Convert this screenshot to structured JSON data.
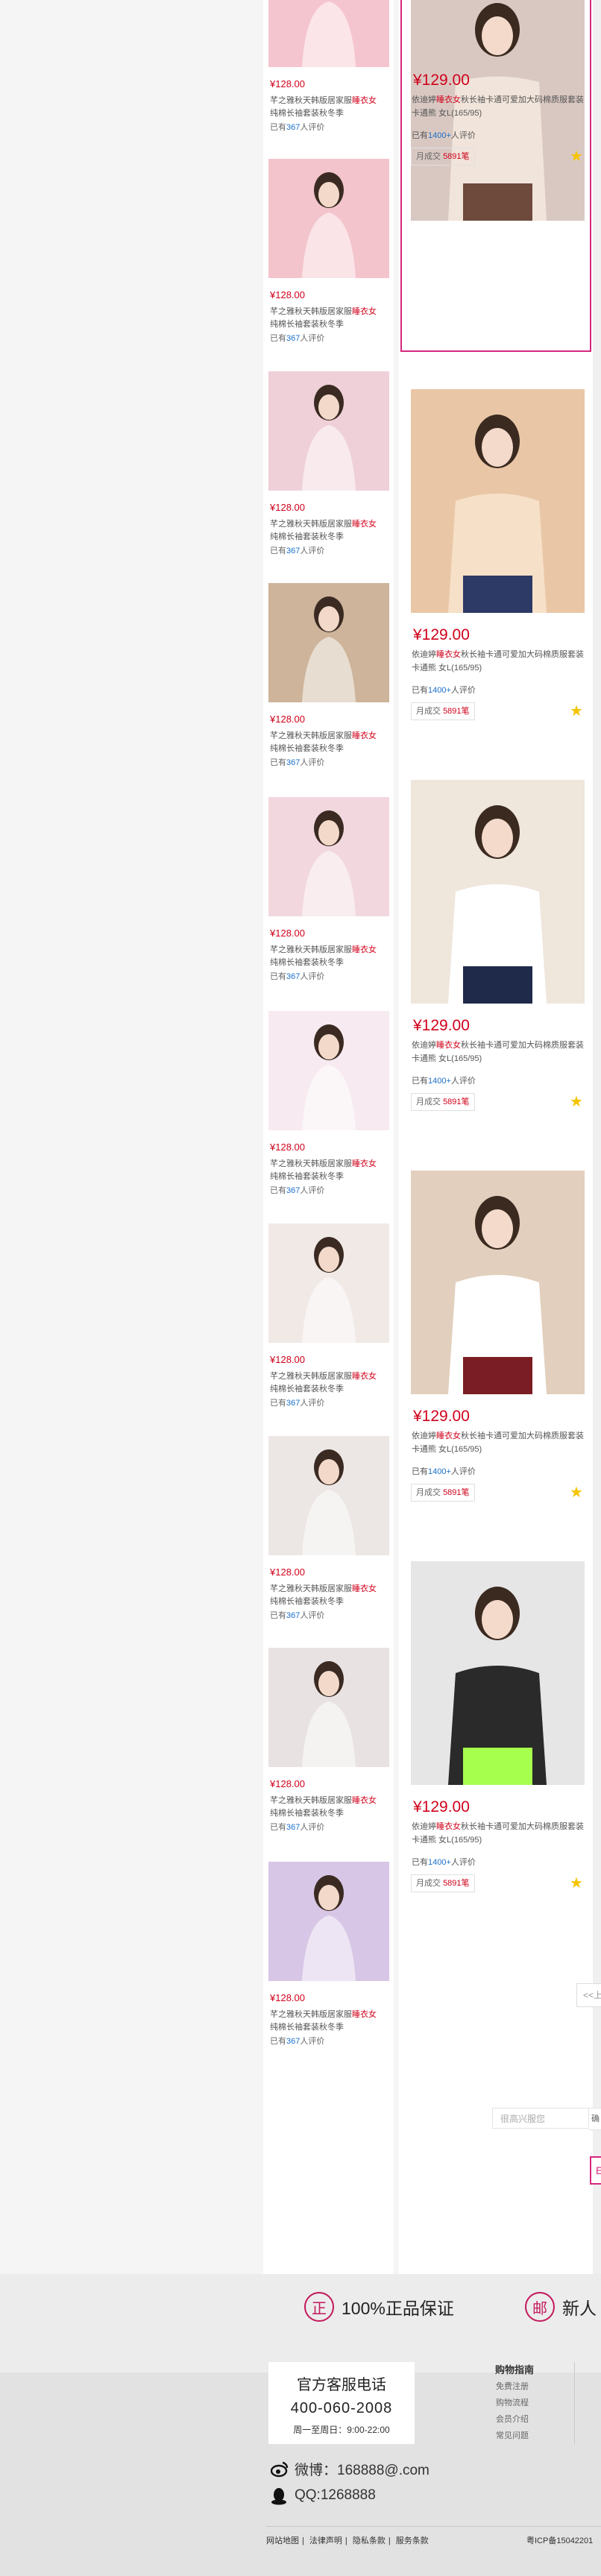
{
  "left_list": {
    "price": "¥128.00",
    "title_pre": "芊之雅秋天韩版居家服",
    "title_hl": "睡衣女",
    "title_post": "纯棉长袖套装秋冬季",
    "review_pre": "已有",
    "review_count": "367",
    "review_post": "人评价"
  },
  "main_list": {
    "price": "¥129.00",
    "title_pre": "依迪婷",
    "title_hl": "睡衣女",
    "title_post": "秋长袖卡通可爱加大码棉质服套装 卡通熊 女L(165/95)",
    "review_pre": "已有",
    "review_count": "1400+",
    "review_post": "人评价",
    "sold_label": "月成交",
    "sold_count": "5891笔"
  },
  "pager": {
    "prev": "<<上",
    "input_placeholder": "很高兴服您",
    "go": "确",
    "box": "E"
  },
  "footer": {
    "guarantee_1_icon": "正",
    "guarantee_1": "100%正品保证",
    "guarantee_2_icon": "邮",
    "guarantee_2": "新人",
    "service_title": "官方客服电话",
    "service_phone": "400-060-2008",
    "service_hours": "周一至周日：9:00-22:00",
    "guide_title": "购物指南",
    "guide_items": [
      "免费注册",
      "购物流程",
      "会员介绍",
      "常见问题"
    ],
    "weibo": "微博：168888@.com",
    "qq": "QQ:1268888",
    "links": [
      "网站地图",
      "法律声明",
      "隐私条款",
      "服务条款"
    ],
    "icp": "粤ICP备15042201"
  },
  "colors": {
    "accent": "#d6287f",
    "price": "#d0021b",
    "link": "#1a6fc9"
  }
}
